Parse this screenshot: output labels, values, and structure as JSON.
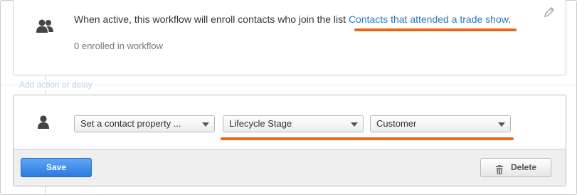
{
  "trigger": {
    "text": "When active, this workflow will enroll contacts who join the list ",
    "list_link": "Contacts that attended a trade show",
    "suffix": ".",
    "enrolled": "0 enrolled in workflow",
    "icon": "users-icon"
  },
  "add_action": "Add action or delay",
  "action": {
    "icon": "user-icon",
    "selects": [
      {
        "value": "Set a contact property ..."
      },
      {
        "value": "Lifecycle Stage"
      },
      {
        "value": "Customer"
      }
    ],
    "save_label": "Save",
    "delete_label": "Delete"
  },
  "colors": {
    "highlight": "#e4691b",
    "link": "#2a7ac0",
    "save_button": "#2c7ae0"
  }
}
